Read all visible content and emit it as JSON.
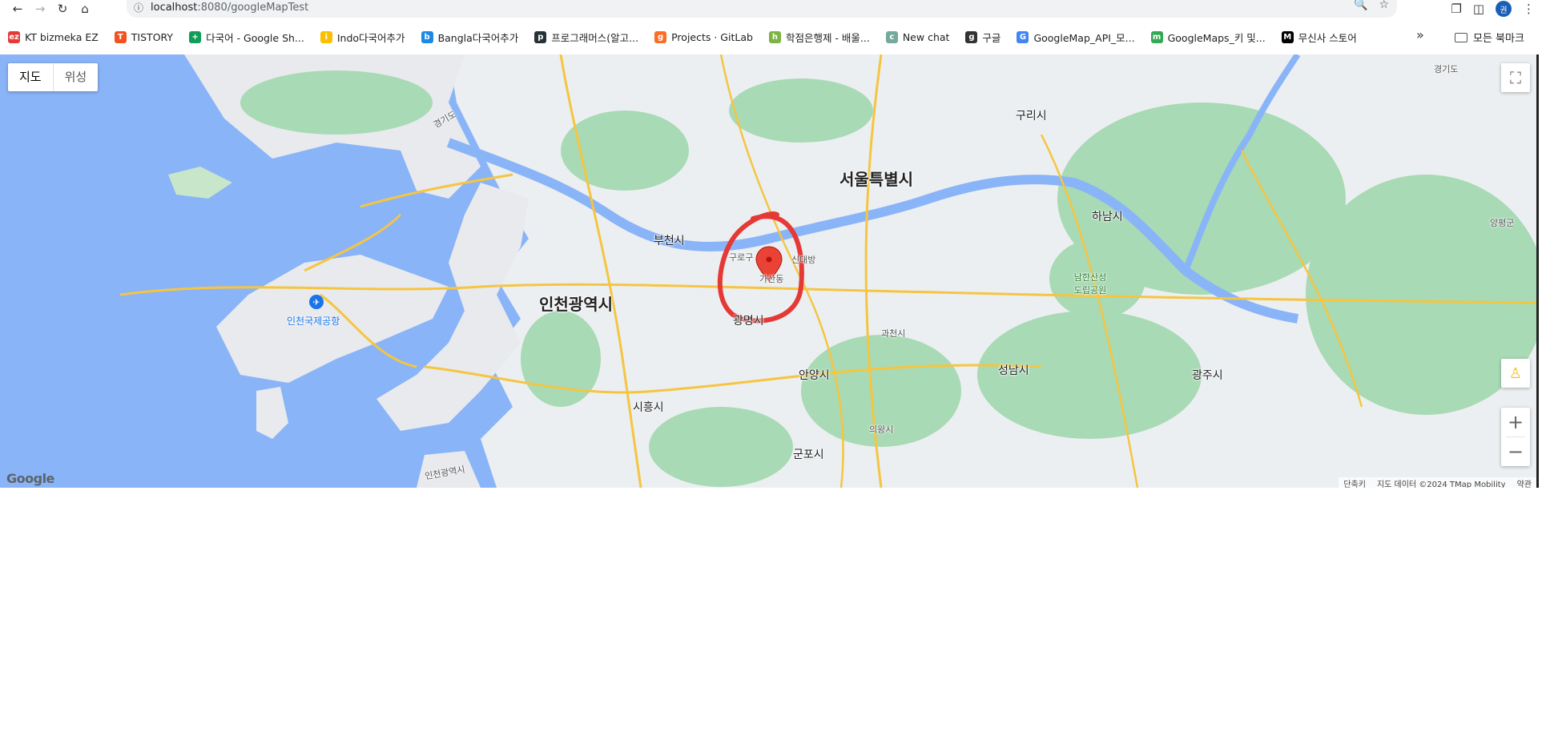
{
  "browser": {
    "url_host": "localhost",
    "url_rest": ":8080/googleMapTest",
    "profile_initial": "권"
  },
  "bookmarks": [
    {
      "label": "KT bizmeka EZ",
      "icon": "bizmeka-icon",
      "color": "#e53935",
      "glyph": "ez"
    },
    {
      "label": "TISTORY",
      "icon": "tistory-icon",
      "color": "#f4511e",
      "glyph": "T"
    },
    {
      "label": "다국어 - Google Sh...",
      "icon": "sheets-icon",
      "color": "#0f9d58",
      "glyph": "+"
    },
    {
      "label": "Indo다국어추가",
      "icon": "indo-icon",
      "color": "#f9c000",
      "glyph": "i"
    },
    {
      "label": "Bangla다국어추가",
      "icon": "bangla-icon",
      "color": "#1e88e5",
      "glyph": "b"
    },
    {
      "label": "프로그래머스(알고...",
      "icon": "programmers-icon",
      "color": "#263238",
      "glyph": "p"
    },
    {
      "label": "Projects · GitLab",
      "icon": "gitlab-icon",
      "color": "#fc6d26",
      "glyph": "g"
    },
    {
      "label": "학점은행제 - 배울...",
      "icon": "school-icon",
      "color": "#7cb342",
      "glyph": "h"
    },
    {
      "label": "New chat",
      "icon": "chatgpt-icon",
      "color": "#74aa9c",
      "glyph": "c"
    },
    {
      "label": "구글",
      "icon": "globe-icon",
      "color": "#333333",
      "glyph": "g"
    },
    {
      "label": "GoogleMap_API_모...",
      "icon": "google-icon",
      "color": "#4285f4",
      "glyph": "G"
    },
    {
      "label": "GoogleMaps_키 및...",
      "icon": "maps-pin-icon",
      "color": "#34a853",
      "glyph": "m"
    },
    {
      "label": "무신사 스토어",
      "icon": "musinsa-icon",
      "color": "#000000",
      "glyph": "M"
    }
  ],
  "bookmarks_all_label": "모든 북마크",
  "map": {
    "type_map_label": "지도",
    "type_satellite_label": "위성",
    "logo": "Google",
    "attribution": {
      "shortcuts": "단축키",
      "data": "지도 데이터 ©2024 TMap Mobility",
      "terms": "약관"
    },
    "labels": {
      "seoul": "서울특별시",
      "incheon": "인천광역시",
      "bucheon": "부천시",
      "gwangmyeong": "광명시",
      "anyang": "안양시",
      "siheung": "시흥시",
      "gunpo": "군포시",
      "uiwang": "의왕시",
      "gwacheon": "과천시",
      "seongnam": "성남시",
      "hanam": "하남시",
      "guri": "구리시",
      "gwangju": "광주시",
      "yangpyeong": "양평군",
      "gyeonggi1": "경기도",
      "gyeonggi2": "경기도",
      "incheon_bay": "인천광역시",
      "incheon_airport": "인천국제공항",
      "namhansan": "남한산성\n도립공원",
      "gasan": "가산동",
      "guro": "구로구",
      "sindaebang": "신대방"
    }
  }
}
